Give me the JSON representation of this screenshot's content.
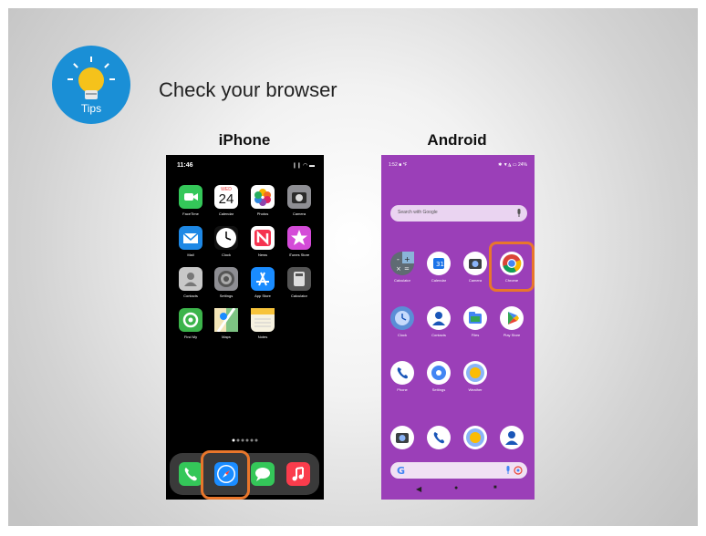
{
  "tips": {
    "label": "Tips",
    "color": "#1a8fd6",
    "icon": "lightbulb-icon"
  },
  "title": "Check your browser",
  "iphone": {
    "label": "iPhone",
    "time": "11:46",
    "signal": "❙❙ ◠ ▬",
    "apps": [
      {
        "label": "FaceTime",
        "icon": "facetime-icon",
        "color": "#34c759"
      },
      {
        "label": "Calendar",
        "icon": "calendar-icon",
        "color": "#ffffff",
        "day": "WED",
        "date": "24"
      },
      {
        "label": "Photos",
        "icon": "photos-icon",
        "color": "#ffffff"
      },
      {
        "label": "Camera",
        "icon": "camera-icon",
        "color": "#8e8e93"
      },
      {
        "label": "Mail",
        "icon": "mail-icon",
        "color": "#1e88e5"
      },
      {
        "label": "Clock",
        "icon": "clock-icon",
        "color": "#111111"
      },
      {
        "label": "News",
        "icon": "news-icon",
        "color": "#ffffff"
      },
      {
        "label": "iTunes Store",
        "icon": "itunes-store-icon",
        "color": "#d44bd8"
      },
      {
        "label": "Contacts",
        "icon": "contacts-icon",
        "color": "#c8c8c8"
      },
      {
        "label": "Settings",
        "icon": "settings-icon",
        "color": "#8e8e93"
      },
      {
        "label": "App Store",
        "icon": "app-store-icon",
        "color": "#1a8cff"
      },
      {
        "label": "Calculator",
        "icon": "calculator-icon",
        "color": "#555555"
      },
      {
        "label": "Find My",
        "icon": "find-my-icon",
        "color": "#3cb44b"
      },
      {
        "label": "Maps",
        "icon": "maps-icon",
        "color": "#6ab04c"
      },
      {
        "label": "Notes",
        "icon": "notes-icon",
        "color": "#f7f2e0"
      }
    ],
    "dock": [
      {
        "icon": "phone-icon",
        "color": "#34c759"
      },
      {
        "icon": "safari-icon",
        "color": "#1a8cff"
      },
      {
        "icon": "messages-icon",
        "color": "#34c759"
      },
      {
        "icon": "music-icon",
        "color": "#fa3c4c"
      }
    ]
  },
  "android": {
    "label": "Android",
    "time": "1:52 ■ ℉",
    "status_right": "✱ ▼◮ ▭ 24%",
    "search_placeholder": "Search with Google",
    "apps": [
      {
        "label": "Calculator",
        "icon": "calculator-icon",
        "color": "#5f6b73"
      },
      {
        "label": "Calendar",
        "icon": "calendar-icon",
        "color": "#ffffff"
      },
      {
        "label": "Camera",
        "icon": "camera-icon",
        "color": "#ffffff"
      },
      {
        "label": "Chrome",
        "icon": "chrome-icon",
        "color": "#ffffff"
      },
      {
        "label": "Clock",
        "icon": "clock-icon",
        "color": "#5b8ed6"
      },
      {
        "label": "Contacts",
        "icon": "contacts-icon",
        "color": "#ffffff"
      },
      {
        "label": "Files",
        "icon": "files-icon",
        "color": "#ffffff"
      },
      {
        "label": "Play Store",
        "icon": "play-store-icon",
        "color": "#ffffff"
      },
      {
        "label": "Phone",
        "icon": "phone-icon",
        "color": "#ffffff"
      },
      {
        "label": "Settings",
        "icon": "settings-icon",
        "color": "#ffffff"
      },
      {
        "label": "Weather",
        "icon": "weather-icon",
        "color": "#ffffff"
      }
    ],
    "dock": [
      {
        "icon": "camera-icon"
      },
      {
        "icon": "phone-icon"
      },
      {
        "icon": "weather-icon"
      },
      {
        "icon": "contacts-icon"
      }
    ],
    "nav": [
      "◀",
      "●",
      "■"
    ]
  },
  "highlight_color": "#e8762b"
}
